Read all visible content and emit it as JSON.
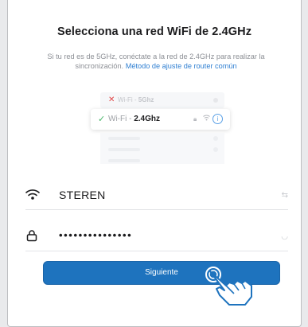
{
  "title": "Selecciona una red WiFi de 2.4GHz",
  "subtitle": {
    "text": "Si tu red es de 5GHz, conéctate a la red de 2.4GHz para realizar la sincronización.",
    "link": "Método de ajuste de router común"
  },
  "illustration": {
    "row_bad": {
      "prefix": "Wi-Fi - ",
      "band": "5Ghz",
      "status_icon": "x-icon"
    },
    "row_good": {
      "prefix": "Wi-Fi - ",
      "band": "2.4Ghz",
      "status_icon": "check-icon"
    }
  },
  "ssid_field": {
    "icon": "wifi-icon",
    "value": "STEREN",
    "side_icon": "swap-icon"
  },
  "password_field": {
    "icon": "lock-icon",
    "value": "•••••••••••••••",
    "side_icon": "eye-closed-icon"
  },
  "next_button": {
    "label": "Siguiente"
  },
  "colors": {
    "accent": "#1e73be",
    "link": "#2f7fd2",
    "check": "#49b66a",
    "error": "#e04848"
  }
}
